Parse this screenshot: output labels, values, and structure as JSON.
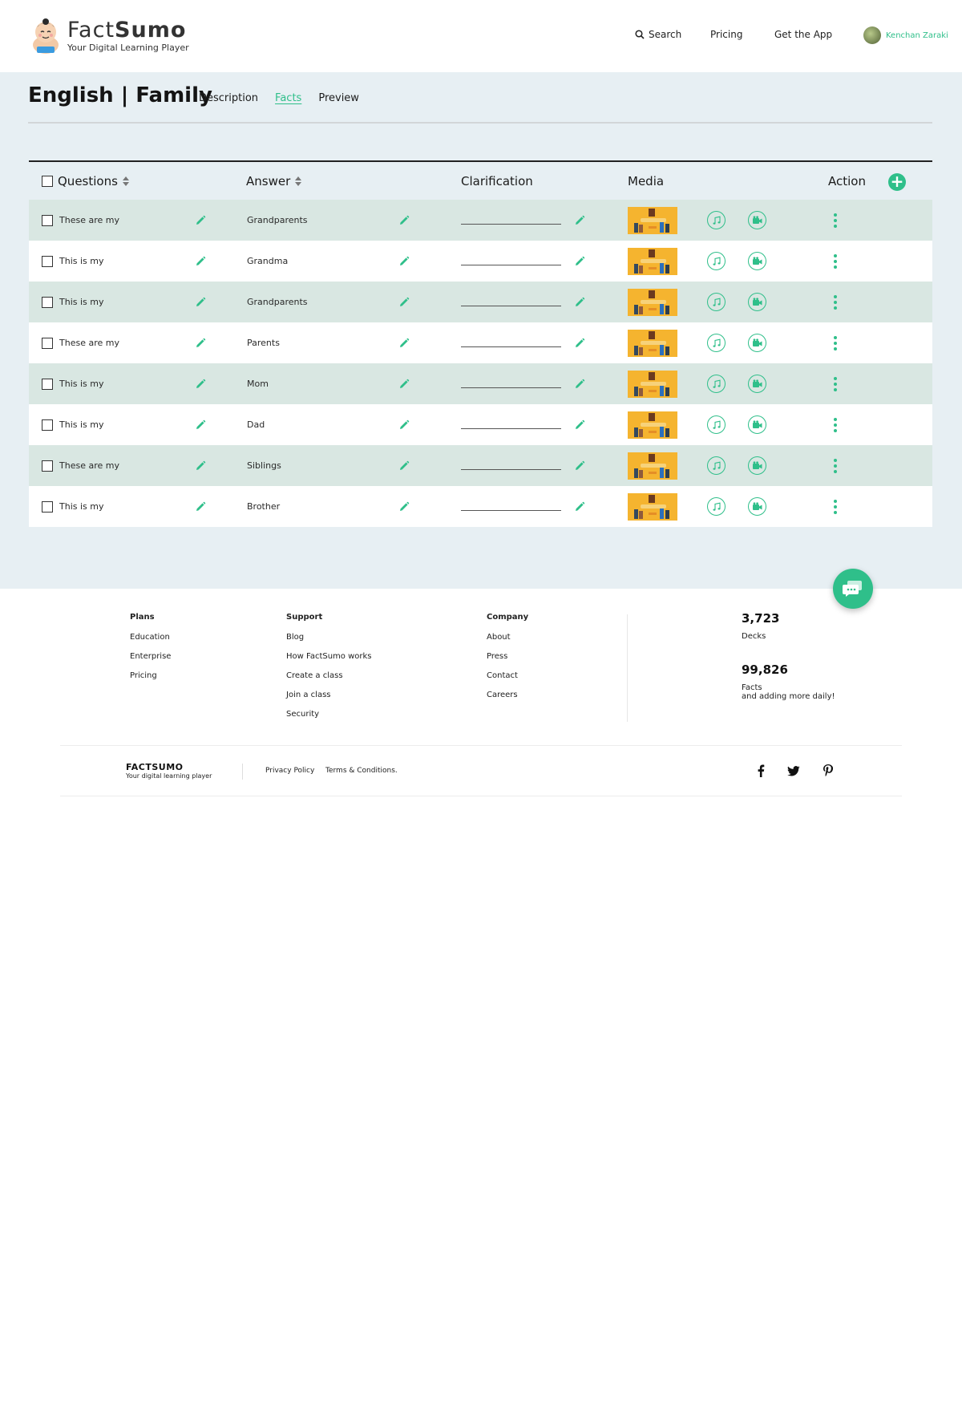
{
  "brand": {
    "name_light": "Fact",
    "name_bold": "Sumo",
    "tagline": "Your Digital Learning Player"
  },
  "nav": {
    "search": "Search",
    "pricing": "Pricing",
    "get_app": "Get the App",
    "user_name": "Kenchan Zaraki"
  },
  "deck": {
    "title": "English | Family",
    "tabs": [
      {
        "label": "Description",
        "active": false
      },
      {
        "label": "Facts",
        "active": true
      },
      {
        "label": "Preview",
        "active": false
      }
    ]
  },
  "table": {
    "headers": {
      "questions": "Questions",
      "answer": "Answer",
      "clarification": "Clarification",
      "media": "Media",
      "action": "Action"
    },
    "rows": [
      {
        "question": "These are my",
        "answer": "Grandparents",
        "clarification": ""
      },
      {
        "question": "This is my",
        "answer": "Grandma",
        "clarification": ""
      },
      {
        "question": "This is my",
        "answer": "Grandparents",
        "clarification": ""
      },
      {
        "question": "These are my",
        "answer": "Parents",
        "clarification": ""
      },
      {
        "question": "This is my",
        "answer": "Mom",
        "clarification": ""
      },
      {
        "question": "This is my",
        "answer": "Dad",
        "clarification": ""
      },
      {
        "question": "These are my",
        "answer": "Siblings",
        "clarification": ""
      },
      {
        "question": "This is my",
        "answer": "Brother",
        "clarification": ""
      }
    ],
    "row_icons": [
      "edit-pencil-icon",
      "media-thumbnail",
      "music-note-icon",
      "video-camera-icon",
      "more-vertical-icon"
    ]
  },
  "footer": {
    "plans": {
      "heading": "Plans",
      "links": [
        "Education",
        "Enterprise",
        "Pricing"
      ]
    },
    "support": {
      "heading": "Support",
      "links": [
        "Blog",
        "How FactSumo works",
        "Create a class",
        "Join a class",
        "Security"
      ]
    },
    "company": {
      "heading": "Company",
      "links": [
        "About",
        "Press",
        "Contact",
        "Careers"
      ]
    },
    "stats": {
      "decks_count": "3,723",
      "decks_label": "Decks",
      "facts_count": "99,826",
      "facts_label_1": "Facts",
      "facts_label_2": "and adding more daily!"
    },
    "brand_name": "FACTSUMO",
    "brand_tagline": "Your digital learning player",
    "privacy": "Privacy Policy",
    "terms": "Terms & Conditions.",
    "social_icons": [
      "facebook-icon",
      "twitter-icon",
      "pinterest-icon"
    ]
  },
  "colors": {
    "accent": "#2fbf8a",
    "main_bg": "#e7eff3",
    "row_shade": "#d9e7e2",
    "thumbnail": "#f5b42f"
  }
}
